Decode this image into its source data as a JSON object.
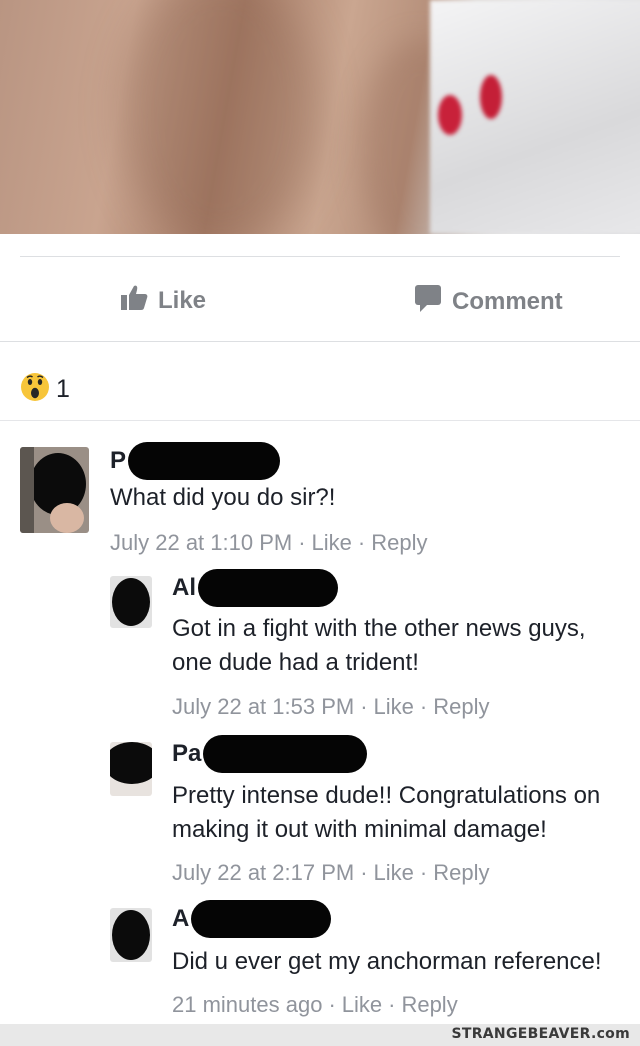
{
  "post": {
    "photo_alt": "blurred post photo",
    "actions": {
      "like_label": "Like",
      "comment_label": "Comment"
    },
    "reactions": {
      "icon": "wow-reaction-icon",
      "count": "1"
    }
  },
  "comments": [
    {
      "name_visible": "P",
      "text": "What did you do sir?!",
      "time": "July 22 at 1:10 PM",
      "like_label": "Like",
      "reply_label": "Reply"
    },
    {
      "name_visible": "Al",
      "text": "Got in a fight with the other news guys, one dude had a trident!",
      "time": "July 22 at 1:53 PM",
      "like_label": "Like",
      "reply_label": "Reply"
    },
    {
      "name_visible": "Pa",
      "text": "Pretty intense dude!! Congratulations on making it out with minimal damage!",
      "time": "July 22 at 2:17 PM",
      "like_label": "Like",
      "reply_label": "Reply"
    },
    {
      "name_visible": "A",
      "text": "Did u ever get my anchorman reference!",
      "time": "21 minutes ago",
      "like_label": "Like",
      "reply_label": "Reply"
    }
  ],
  "meta_separator": "·",
  "watermark": "STRANGEBEAVER.com",
  "colors": {
    "meta": "#90949c",
    "action": "#7f8287",
    "text": "#1d2129",
    "separator": "#dddfe2"
  }
}
